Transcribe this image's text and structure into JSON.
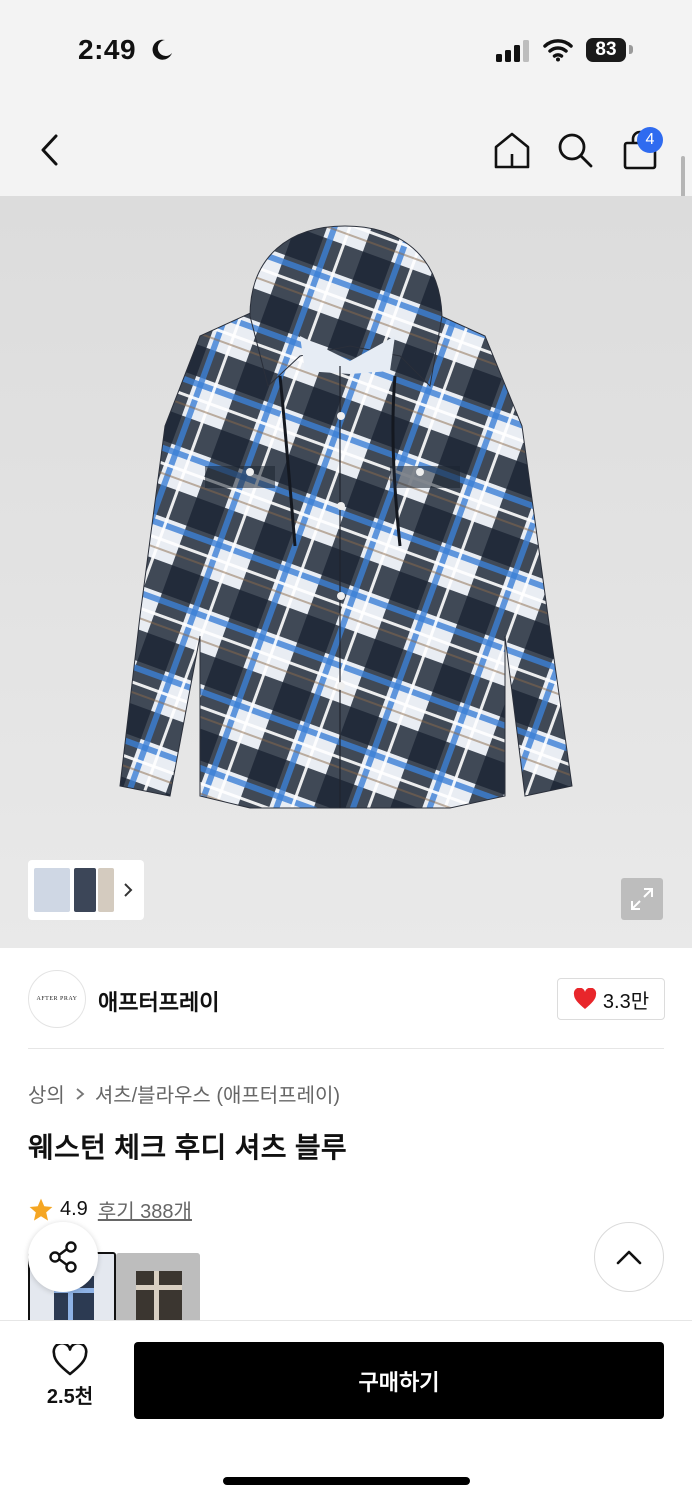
{
  "status_bar": {
    "time": "2:49",
    "battery": "83"
  },
  "nav": {
    "back_icon": "chevron-left-icon",
    "home_icon": "home-icon",
    "search_icon": "search-icon",
    "cart_icon": "shopping-bag-icon",
    "cart_count": "4"
  },
  "gallery": {
    "expand_icon": "expand-icon"
  },
  "brand": {
    "logo_text": "AFTER PRAY",
    "name": "애프터프레이",
    "likes": "3.3만"
  },
  "product": {
    "category": "상의",
    "subcategory": "셔츠/블라우스 (애프터프레이)",
    "title": "웨스턴 체크 후디 셔츠 블루",
    "rating": "4.9",
    "reviews": "후기 388개"
  },
  "bottom": {
    "wish_count": "2.5천",
    "buy_label": "구매하기"
  },
  "colors": {
    "accent_blue": "#2f6bf0",
    "heart_red": "#e8262b",
    "star": "#f5a623"
  }
}
